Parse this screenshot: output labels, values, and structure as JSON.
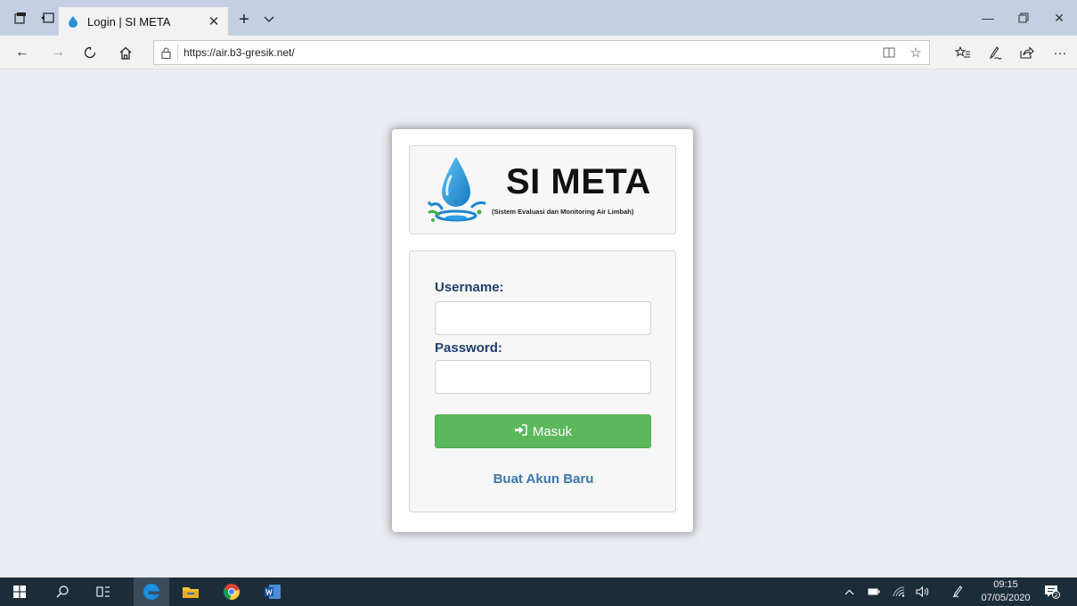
{
  "browser": {
    "tab_title": "Login | SI META",
    "url": "https://air.b3-gresik.net/"
  },
  "page": {
    "logo_title": "SI META",
    "logo_subtitle": "(Sistem Evaluasi dan Monitoring Air Limbah)",
    "username_label": "Username:",
    "password_label": "Password:",
    "submit_label": "Masuk",
    "register_link": "Buat Akun Baru",
    "username_value": "",
    "password_value": ""
  },
  "taskbar": {
    "time": "09:15",
    "date": "07/05/2020",
    "notification_count": "2"
  },
  "colors": {
    "accent_green": "#5cb85c",
    "label_navy": "#1f3e6e",
    "link_blue": "#3c77ad",
    "page_bg": "#eaedf2",
    "tabbar_bg": "#c5cfe4",
    "taskbar_bg": "#1c2d3a"
  },
  "icons": {
    "tabbar_left": [
      "set-aside-tabs-icon",
      "show-tabs-icon"
    ],
    "tab": "water-drop-favicon",
    "nav": [
      "back-arrow-icon",
      "forward-arrow-icon",
      "refresh-icon",
      "home-icon",
      "lock-icon"
    ],
    "address_right": [
      "reading-view-icon",
      "favorite-star-icon"
    ],
    "toolbar": [
      "favorites-list-icon",
      "pen-icon",
      "share-icon",
      "more-icon"
    ],
    "taskbar": [
      "windows-start-icon",
      "search-icon",
      "task-view-icon",
      "edge-icon",
      "file-explorer-icon",
      "chrome-icon",
      "word-icon"
    ],
    "tray": [
      "chevron-up-icon",
      "battery-icon",
      "wifi-icon",
      "volume-icon",
      "pen-workspace-icon",
      "notification-icon"
    ]
  }
}
